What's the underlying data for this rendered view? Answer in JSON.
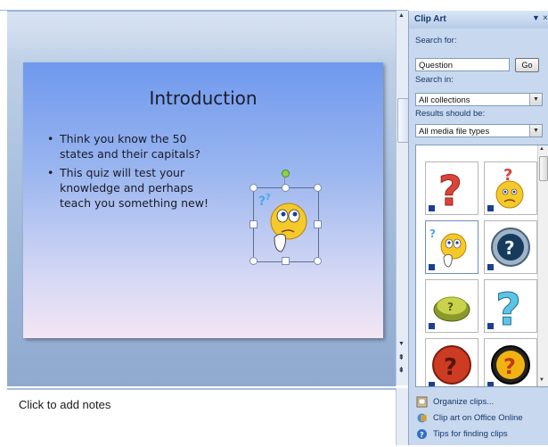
{
  "slide": {
    "title": "Introduction",
    "bullets": [
      "Think you know the 50 states and their capitals?",
      "This quiz will test your knowledge and perhaps teach you something new!"
    ]
  },
  "notes": {
    "placeholder": "Click to add notes"
  },
  "clipart": {
    "title": "Clip Art",
    "search_label": "Search for:",
    "search_value": "Question",
    "go_label": "Go",
    "search_in_label": "Search in:",
    "search_in_value": "All collections",
    "results_label": "Results should be:",
    "results_value": "All media file types",
    "links": [
      "Organize clips...",
      "Clip art on Office Online",
      "Tips for finding clips"
    ]
  },
  "colors": {
    "pane_text": "#15386b",
    "slide_gradient_top": "#6f99ee",
    "slide_gradient_bottom": "#f3e6f3"
  }
}
